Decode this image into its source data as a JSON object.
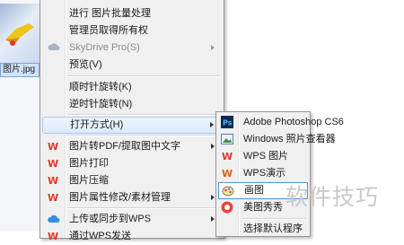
{
  "file": {
    "name": "图片.jpg"
  },
  "context_menu": {
    "items": [
      {
        "label": "进行 图片批量处理",
        "icon": "none"
      },
      {
        "label": "管理员取得所有权",
        "icon": "none"
      },
      {
        "label": "SkyDrive Pro(S)",
        "icon": "skydrive-icon",
        "disabled": true,
        "submenu": true
      },
      {
        "label": "预览(V)",
        "icon": "none"
      },
      {
        "label": "顺时针旋转(K)",
        "icon": "none"
      },
      {
        "label": "逆时针旋转(N)",
        "icon": "none"
      },
      {
        "label": "打开方式(H)",
        "icon": "none",
        "submenu": true,
        "highlighted": true
      },
      {
        "label": "图片转PDF/提取图中文字",
        "icon": "wps-icon",
        "submenu": true
      },
      {
        "label": "图片打印",
        "icon": "wps-icon"
      },
      {
        "label": "图片压缩",
        "icon": "wps-icon"
      },
      {
        "label": "图片属性修改/素材管理",
        "icon": "wps-icon",
        "submenu": true
      },
      {
        "label": "上传或同步到WPS",
        "icon": "cloud-icon",
        "submenu": true
      },
      {
        "label": "通过WPS发送",
        "icon": "wps-icon"
      }
    ]
  },
  "open_with_submenu": {
    "items": [
      {
        "label": "Adobe Photoshop CS6",
        "icon": "photoshop-icon"
      },
      {
        "label": "Windows 照片查看器",
        "icon": "photo-viewer-icon"
      },
      {
        "label": "WPS 图片",
        "icon": "wps-icon"
      },
      {
        "label": "WPS演示",
        "icon": "wps-presentation-icon"
      },
      {
        "label": "画图",
        "icon": "paint-icon",
        "highlighted": true
      },
      {
        "label": "美图秀秀",
        "icon": "meitu-icon"
      },
      {
        "label": "选择默认程序",
        "icon": "none"
      }
    ]
  },
  "watermark": "软件技巧",
  "colors": {
    "wps_red": "#d83a2b",
    "highlight_border": "#4f8fd6",
    "menu_bg": "#f0f0f0"
  }
}
